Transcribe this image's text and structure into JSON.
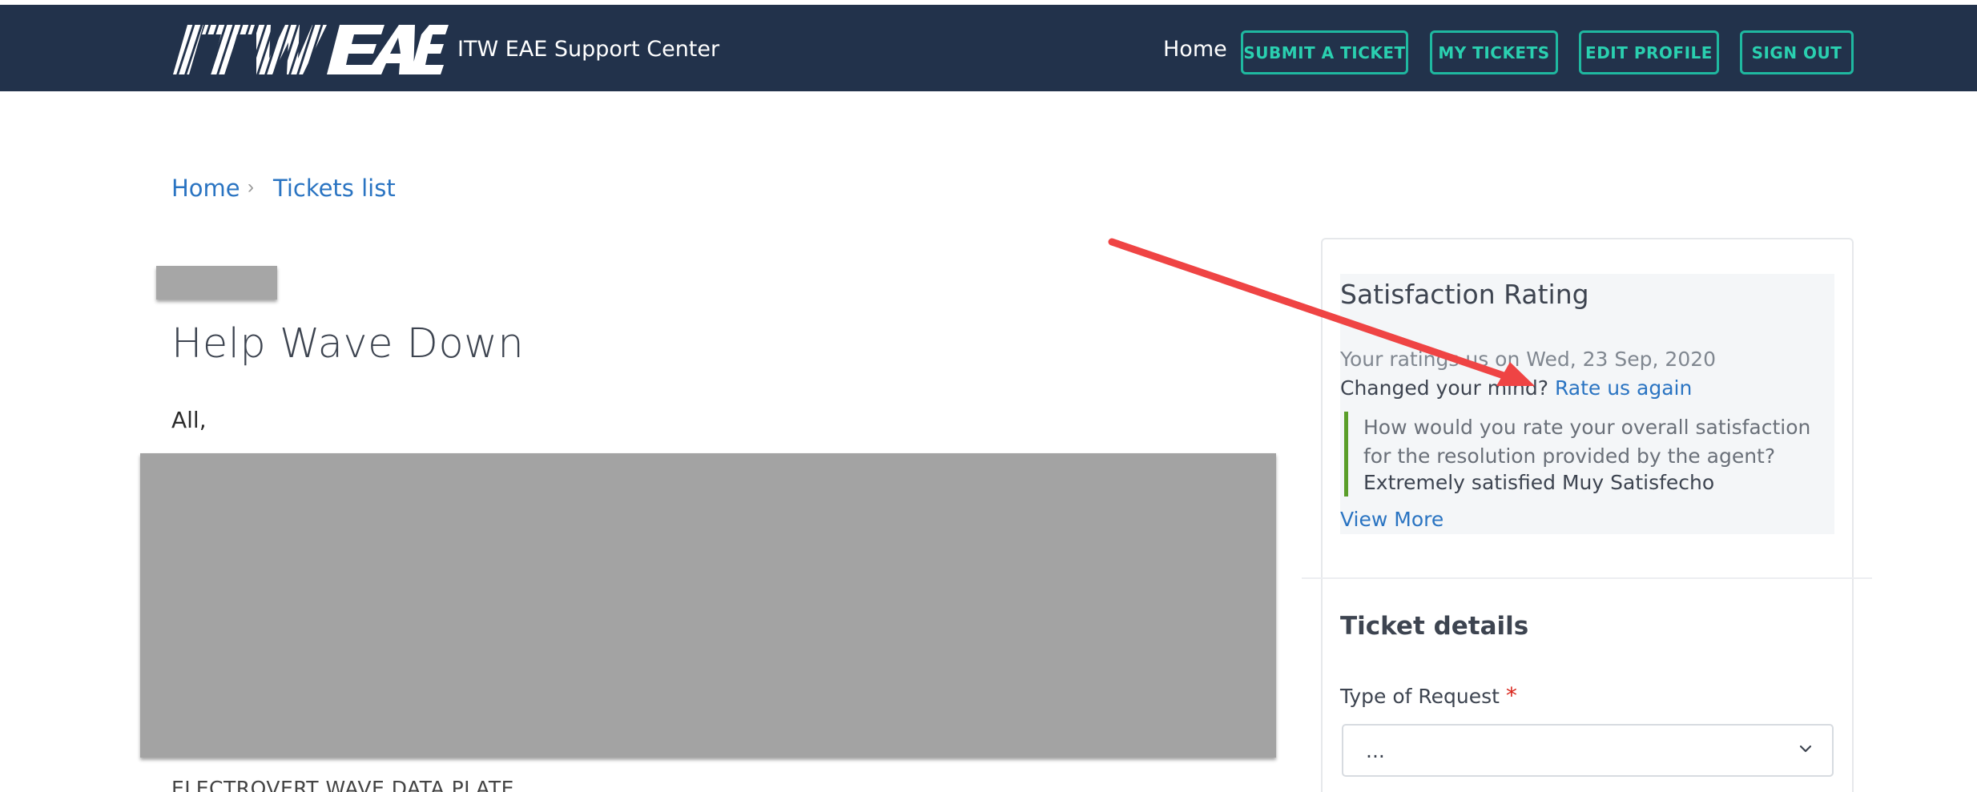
{
  "header": {
    "logo_text": "ITW EAE",
    "site_title": "ITW EAE Support Center",
    "nav": {
      "home": "Home",
      "submit_ticket": "SUBMIT A TICKET",
      "my_tickets": "MY TICKETS",
      "edit_profile": "EDIT PROFILE",
      "sign_out": "SIGN OUT"
    },
    "colors": {
      "background": "#22324b",
      "accent": "#1fb8a0"
    }
  },
  "breadcrumb": {
    "items": [
      "Home",
      "Tickets list"
    ],
    "separator": "›"
  },
  "ticket": {
    "title": "Help Wave Down",
    "greeting": "All,",
    "cut_text": "ELECTROVERT WAVE DATA PLATE"
  },
  "satisfaction": {
    "title": "Satisfaction Rating",
    "rated_on": "Your ratings us on Wed, 23 Sep, 2020",
    "changed_mind": "Changed your mind?",
    "rate_again": "Rate us again",
    "question": "How would you rate your overall satisfaction for the resolution provided by the agent?",
    "answer": "Extremely satisfied Muy Satisfecho",
    "view_more": "View More"
  },
  "details": {
    "title": "Ticket details",
    "type_label": "Type of Request",
    "required_mark": "*",
    "type_value": "...",
    "chevron_icon": "chevron-down-icon"
  },
  "annotation": {
    "arrow_color": "#ef4444"
  }
}
